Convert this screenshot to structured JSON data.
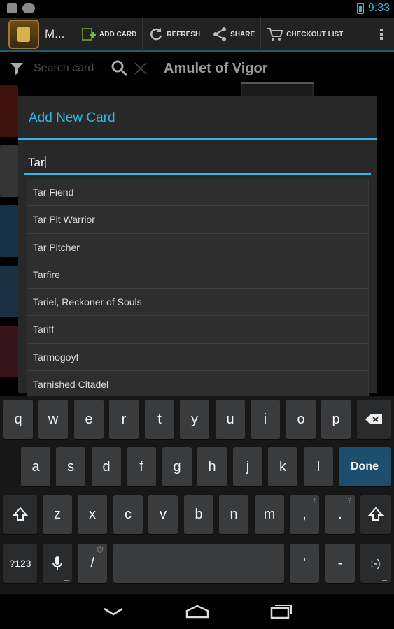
{
  "status_bar": {
    "time": "9:33"
  },
  "action_bar": {
    "title": "M...",
    "add_card": "ADD CARD",
    "refresh": "REFRESH",
    "share": "SHARE",
    "checkout_list": "CHECKOUT LIST"
  },
  "search": {
    "placeholder": "Search card",
    "current_card": "Amulet of Vigor"
  },
  "dialog": {
    "title": "Add New Card",
    "input_value": "Tar",
    "suggestions": [
      "Tar Fiend",
      "Tar Pit Warrior",
      "Tar Pitcher",
      "Tarfire",
      "Tariel, Reckoner of Souls",
      "Tariff",
      "Tarmogoyf",
      "Tarnished Citadel"
    ]
  },
  "keyboard": {
    "row1": [
      "q",
      "w",
      "e",
      "r",
      "t",
      "y",
      "u",
      "i",
      "o",
      "p"
    ],
    "row2": [
      "a",
      "s",
      "d",
      "f",
      "g",
      "h",
      "j",
      "k",
      "l"
    ],
    "row3": [
      "z",
      "x",
      "c",
      "v",
      "b",
      "n",
      "m",
      ",",
      "."
    ],
    "row3_hints": [
      "!",
      "?"
    ],
    "done": "Done",
    "symbols": "?123",
    "slash": "/",
    "apostrophe": "'",
    "dash": "-",
    "smiley": ":-)"
  },
  "colors": {
    "accent": "#33b5e5",
    "done_key": "#1d4e6e"
  },
  "icons": [
    "filter-icon",
    "search-icon",
    "close-icon",
    "add-card-icon",
    "refresh-icon",
    "share-icon",
    "cart-icon",
    "overflow-icon",
    "backspace-icon",
    "shift-icon",
    "mic-icon",
    "back-icon",
    "home-icon",
    "recents-icon"
  ]
}
